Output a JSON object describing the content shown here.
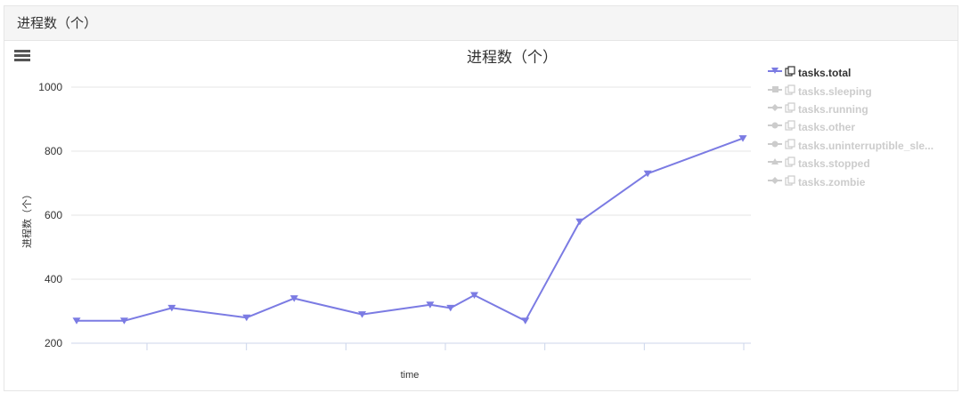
{
  "panel": {
    "header_title": "进程数（个）"
  },
  "chart_data": {
    "type": "line",
    "title": "进程数（个）",
    "xlabel": "time",
    "ylabel": "进程数（个）",
    "ylim": [
      200,
      1000
    ],
    "yticks": [
      200,
      400,
      600,
      800,
      1000
    ],
    "grid": true,
    "legend_position": "right",
    "x_tick_count": 7,
    "x": [
      0,
      0.7,
      1.4,
      2.5,
      3.2,
      4.2,
      5.2,
      5.5,
      5.85,
      6.6,
      7.4,
      8.4,
      9.8
    ],
    "series": [
      {
        "name": "tasks.total",
        "visible": true,
        "color": "#7b7be3",
        "marker": "triangle-down",
        "values": [
          270,
          270,
          310,
          280,
          340,
          290,
          320,
          310,
          350,
          270,
          580,
          730,
          840
        ]
      },
      {
        "name": "tasks.sleeping",
        "visible": false,
        "marker": "square",
        "values": []
      },
      {
        "name": "tasks.running",
        "visible": false,
        "marker": "diamond",
        "values": []
      },
      {
        "name": "tasks.other",
        "visible": false,
        "marker": "circle",
        "values": []
      },
      {
        "name": "tasks.uninterruptible_sle...",
        "visible": false,
        "marker": "circle",
        "values": []
      },
      {
        "name": "tasks.stopped",
        "visible": false,
        "marker": "triangle",
        "values": []
      },
      {
        "name": "tasks.zombie",
        "visible": false,
        "marker": "diamond",
        "values": []
      }
    ]
  },
  "colors": {
    "series_active": "#7b7be3",
    "legend_hidden": "#cccccc",
    "grid": "#e6e6e6",
    "axis": "#ccd6eb"
  },
  "icons": {
    "menu": "hamburger-menu-icon",
    "legend_copy": "copy-icon"
  }
}
